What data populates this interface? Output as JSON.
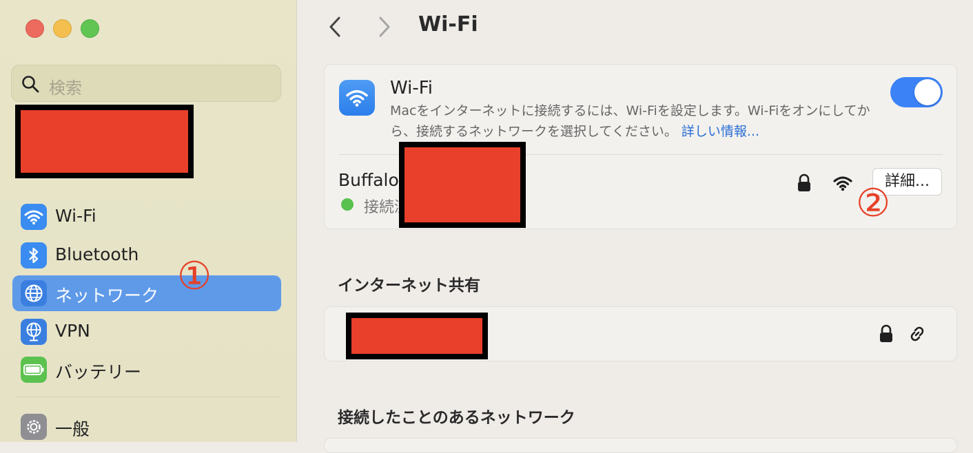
{
  "window": {
    "title": "Wi-Fi"
  },
  "sidebar": {
    "search": {
      "placeholder": "検索"
    },
    "items": [
      {
        "label": "Wi-Fi",
        "icon": "wifi-icon"
      },
      {
        "label": "Bluetooth",
        "icon": "bluetooth-icon"
      },
      {
        "label": "ネットワーク",
        "icon": "globe-icon",
        "selected": true
      },
      {
        "label": "VPN",
        "icon": "vpn-globe-icon"
      },
      {
        "label": "バッテリー",
        "icon": "battery-icon"
      },
      {
        "label": "一般",
        "icon": "gear-icon"
      }
    ]
  },
  "annotations": {
    "one": "①",
    "two": "②"
  },
  "main": {
    "wifi_card": {
      "title": "Wi-Fi",
      "description": "Macをインターネットに接続するには、Wi-Fiを設定します。Wi-Fiをオンにしてから、接続するネットワークを選択してください。",
      "link": "詳しい情報...",
      "toggle_on": true
    },
    "connected_network": {
      "name": "Buffalo-",
      "status": "接続済",
      "details_button": "詳細..."
    },
    "sections": {
      "internet_sharing": "インターネット共有",
      "known_networks": "接続したことのあるネットワーク"
    }
  },
  "colors": {
    "accent": "#3b82f6",
    "selected": "#5f9ae9",
    "redaction": "#e8402a",
    "annotation": "#e64027"
  }
}
